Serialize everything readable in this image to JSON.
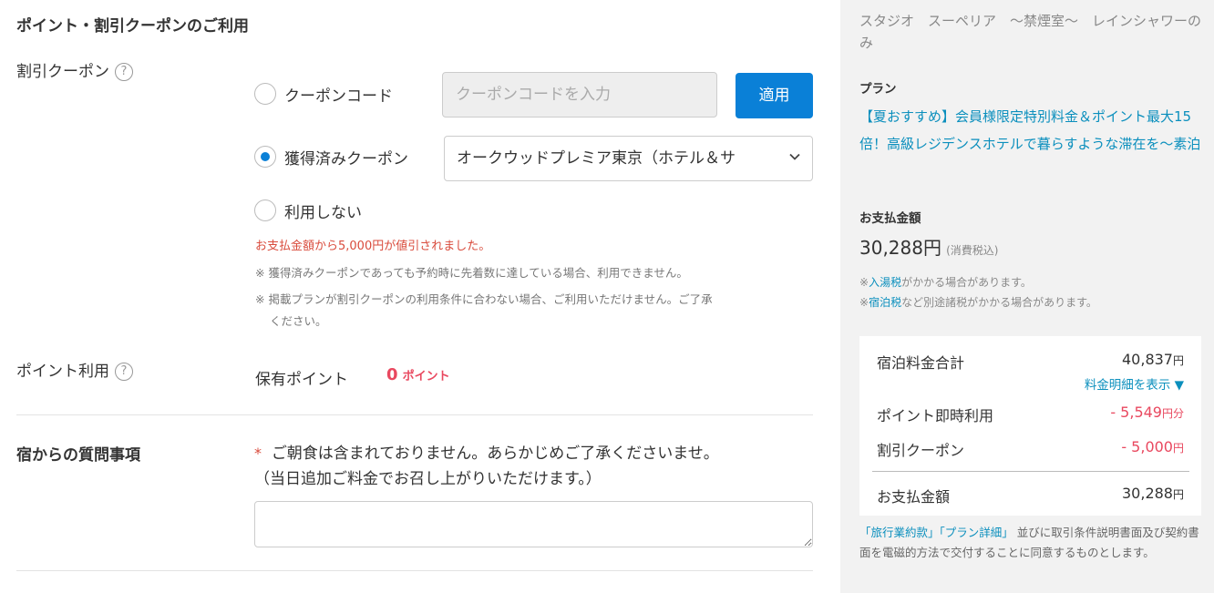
{
  "main": {
    "title": "ポイント・割引クーポンのご利用",
    "coupon": {
      "label": "割引クーポン",
      "help": "?",
      "options": [
        {
          "label": "クーポンコード",
          "checked": false
        },
        {
          "label": "獲得済みクーポン",
          "checked": true
        },
        {
          "label": "利用しない",
          "checked": false
        }
      ],
      "code_placeholder": "クーポンコードを入力",
      "apply_label": "適用",
      "selected_coupon": "オークウッドプレミア東京（ホテル＆サ",
      "discount_message": "お支払金額から5,000円が値引されました。",
      "notes": [
        "※ 獲得済みクーポンであっても予約時に先着数に達している場合、利用できません。",
        "※ 掲載プランが割引クーポンの利用条件に合わない場合、ご利用いただけません。ご了承",
        "ください。"
      ]
    },
    "points": {
      "label": "ポイント利用",
      "help": "?",
      "held_label": "保有ポイント",
      "held_value": "0",
      "unit": "ポイント"
    },
    "question": {
      "title": "宿からの質問事項",
      "asterisk": "*",
      "line1": "ご朝食は含まれておりません。あらかじめご了承くださいませ。",
      "line2": "（当日追加ご料金でお召し上がりいただけます。）"
    }
  },
  "sidebar": {
    "room": "スタジオ　スーペリア　～禁煙室～　レインシャワーのみ",
    "plan_label": "プラン",
    "plan_name": "【夏おすすめ】会員様限定特別料金＆ポイント最大15倍！高級レジデンスホテルで暮らすような滞在を～素泊",
    "total_label": "お支払金額",
    "total_value": "30,288円",
    "total_tax": "(消費税込)",
    "tax_note1_prefix": "※",
    "tax_note1_link": "入湯税",
    "tax_note1_suffix": "がかかる場合があります。",
    "tax_note2_prefix": "※",
    "tax_note2_link": "宿泊税",
    "tax_note2_suffix": "など別途諸税がかかる場合があります。",
    "summary": {
      "room_total_label": "宿泊料金合計",
      "room_total_value": "40,837",
      "yen": "円",
      "detail_link": "料金明細を表示 ▼",
      "points_label": "ポイント即時利用",
      "points_value": "- 5,549",
      "points_unit": "円分",
      "coupon_label": "割引クーポン",
      "coupon_value": "- 5,000",
      "pay_label": "お支払金額",
      "pay_value": "30,288"
    },
    "agree_link1": "「旅行業約款」",
    "agree_link2": "「プラン詳細」",
    "agree_text": "並びに取引条件説明書面及び契約書面を電磁的方法で交付することに同意するものとします。"
  }
}
